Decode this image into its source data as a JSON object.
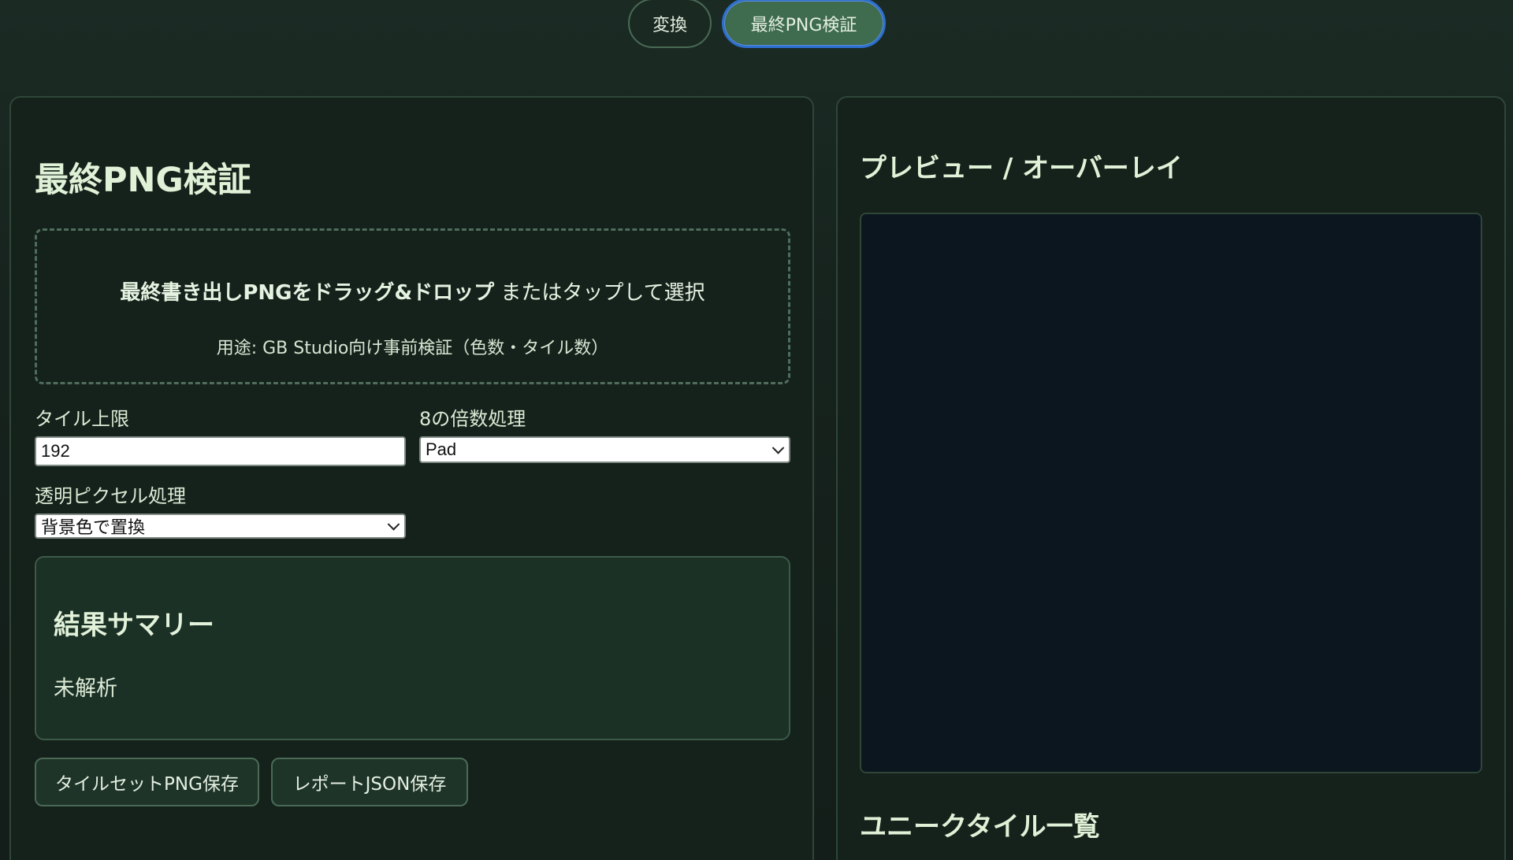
{
  "tabs": [
    {
      "label": "変換",
      "active": false
    },
    {
      "label": "最終PNG検証",
      "active": true
    }
  ],
  "left": {
    "title": "最終PNG検証",
    "dropzone": {
      "main_bold": "最終書き出しPNGをドラッグ&ドロップ",
      "main_rest": " またはタップして選択",
      "sub": "用途: GB Studio向け事前検証（色数・タイル数）"
    },
    "tile_limit": {
      "label": "タイル上限",
      "value": "192"
    },
    "multiple8": {
      "label": "8の倍数処理",
      "selected": "Pad"
    },
    "transparent": {
      "label": "透明ピクセル処理",
      "selected": "背景色で置換"
    },
    "summary": {
      "title": "結果サマリー",
      "text": "未解析"
    },
    "buttons": {
      "save_tileset": "タイルセットPNG保存",
      "save_report": "レポートJSON保存"
    }
  },
  "right": {
    "preview_title": "プレビュー / オーバーレイ",
    "unique_title": "ユニークタイル一覧"
  },
  "colors": {
    "active_tab_bg": "#3f6b4f",
    "active_tab_border": "#2d6fcf",
    "preview_bg": "#0b161e",
    "summary_bg": "#1c3126"
  }
}
